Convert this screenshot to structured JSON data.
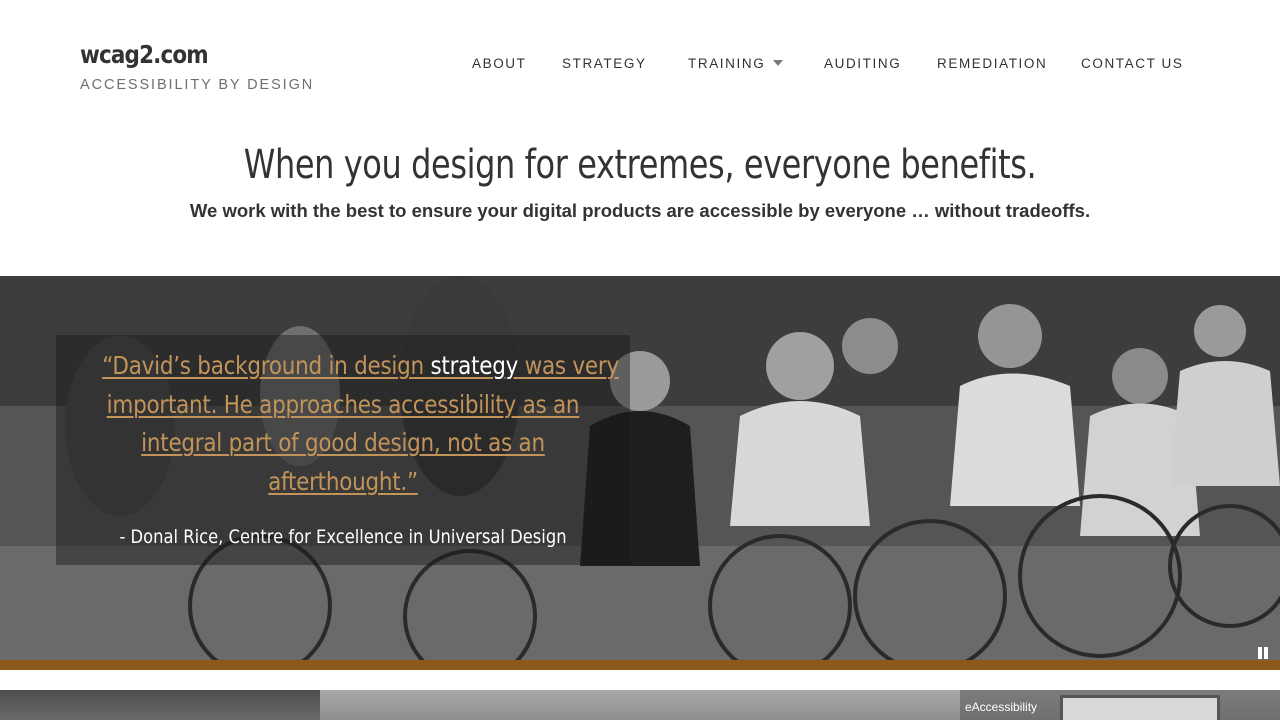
{
  "site": {
    "name": "wcag2.com",
    "tagline": "ACCESSIBILITY BY DESIGN"
  },
  "nav": {
    "items": [
      {
        "label": "ABOUT"
      },
      {
        "label": "STRATEGY"
      },
      {
        "label": "TRAINING",
        "has_dropdown": true
      },
      {
        "label": "AUDITING"
      },
      {
        "label": "REMEDIATION"
      },
      {
        "label": "CONTACT US"
      }
    ]
  },
  "hero": {
    "heading": "When you design for extremes, everyone benefits.",
    "subheading": "We work with the best to ensure your digital products are accessible by everyone … without tradeoffs."
  },
  "slide": {
    "quote_lines": [
      {
        "before": "“David’s background in design ",
        "highlight": "strategy",
        "after": " was very"
      },
      {
        "before": "important. He approaches accessibility as an",
        "highlight": "",
        "after": ""
      },
      {
        "before": "integral part of good design, not as an",
        "highlight": "",
        "after": ""
      },
      {
        "before": "afterthought.”",
        "highlight": "",
        "after": ""
      }
    ],
    "author": "- Donal Rice, Centre for Excellence in Universal Design",
    "pause_icon": "pause-icon"
  },
  "cards": {
    "third_label": "eAccessibility"
  },
  "colors": {
    "text": "#333333",
    "tagline": "#6f6f6f",
    "quote": "#c2945a",
    "accent_bar": "#8b5a1b"
  }
}
